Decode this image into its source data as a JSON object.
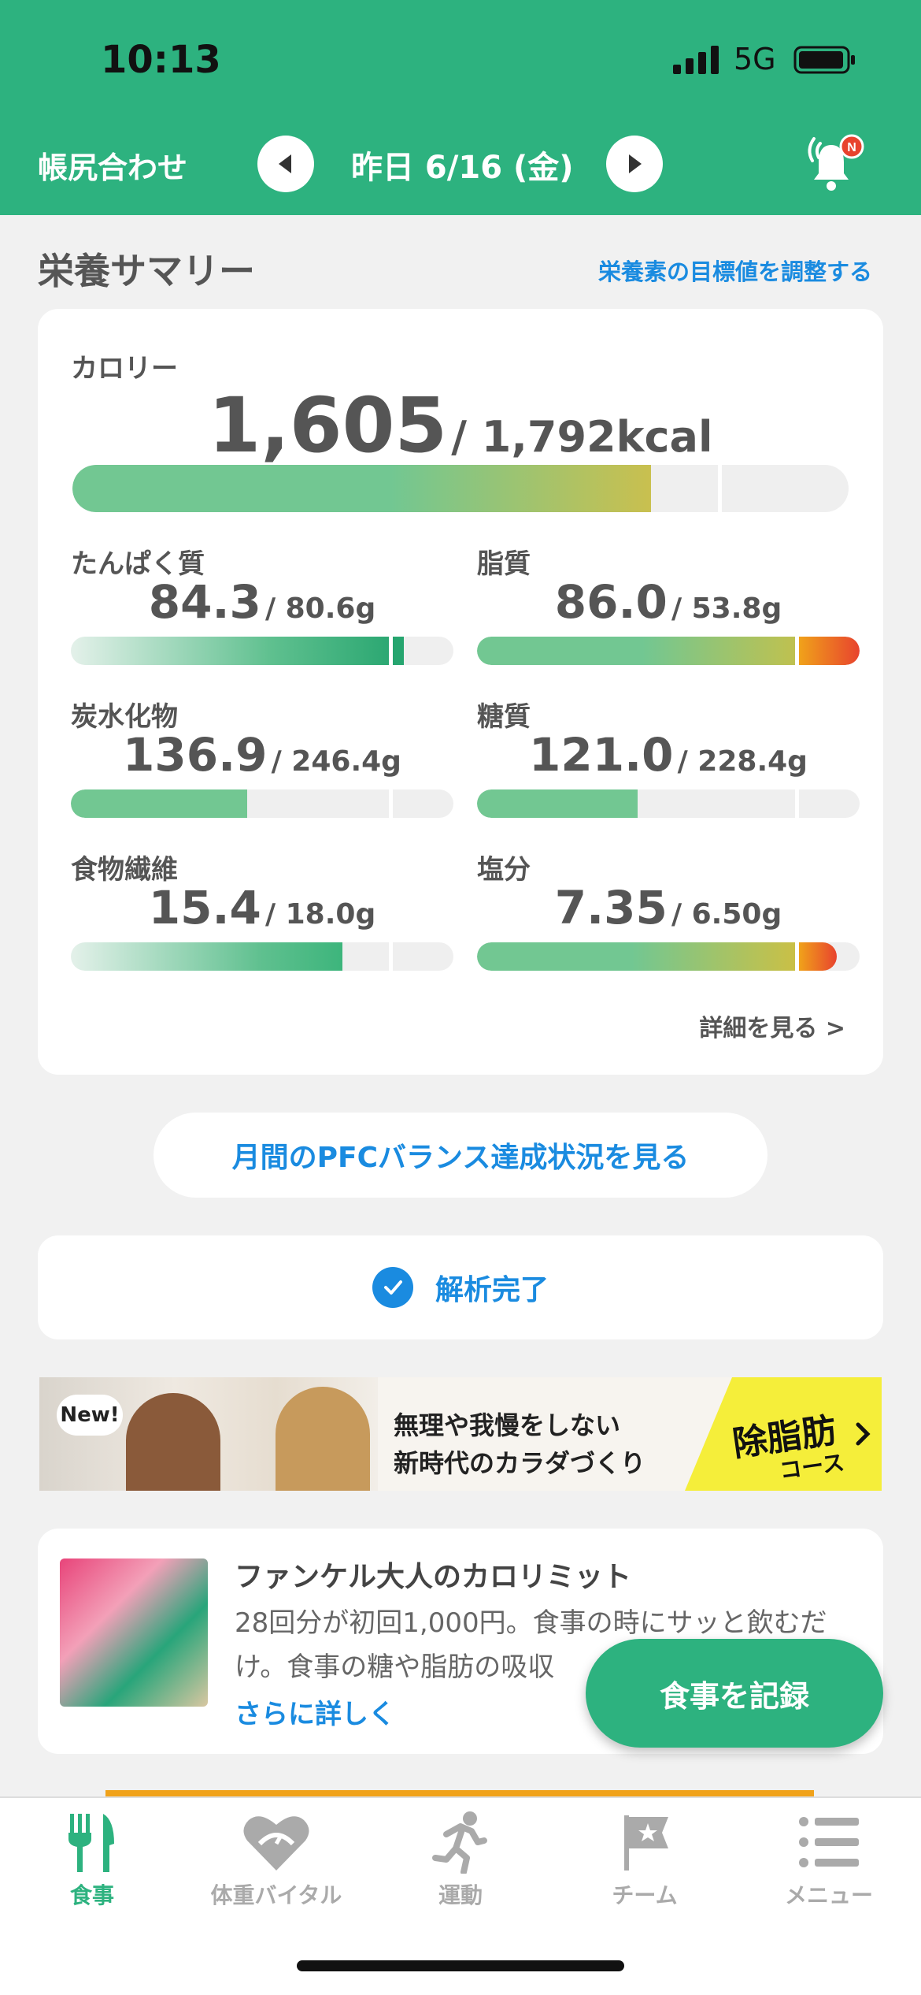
{
  "status_bar": {
    "time": "10:13",
    "network": "5G"
  },
  "header": {
    "left_label": "帳尻合わせ",
    "date": "昨日 6/16 (金)",
    "notification_badge": "N",
    "accent_color": "#2db27f"
  },
  "summary": {
    "title": "栄養サマリー",
    "adjust_link": "栄養素の目標値を調整する",
    "calorie": {
      "label": "カロリー",
      "value": "1,605",
      "target": "/ 1,792kcal",
      "progress": 0.745
    },
    "nutrients": [
      {
        "label": "たんぱく質",
        "value": "84.3",
        "target": "/ 80.6g",
        "progress": 0.87,
        "status": "over"
      },
      {
        "label": "脂質",
        "value": "86.0",
        "target": "/ 53.8g",
        "progress": 0.96,
        "status": "over"
      },
      {
        "label": "炭水化物",
        "value": "136.9",
        "target": "/ 246.4g",
        "progress": 0.46,
        "status": "under"
      },
      {
        "label": "糖質",
        "value": "121.0",
        "target": "/ 228.4g",
        "progress": 0.42,
        "status": "under"
      },
      {
        "label": "食物繊維",
        "value": "15.4",
        "target": "/ 18.0g",
        "progress": 0.71,
        "status": "under"
      },
      {
        "label": "塩分",
        "value": "7.35",
        "target": "/ 6.50g",
        "progress": 0.9,
        "status": "over"
      }
    ],
    "detail_link": "詳細を見る >"
  },
  "pfc_button": "月間のPFCバランス達成状況を見る",
  "analysis": {
    "label": "解析完了"
  },
  "banner": {
    "badge": "New!",
    "line1": "無理や我慢をしない",
    "line2": "新時代のカラダづくり",
    "course_main": "除脂肪",
    "course_sub": "コース"
  },
  "ad": {
    "title": "ファンケル大人のカロリミット",
    "body": "28回分が初回1,000円。食事の時にサッと飲むだけ。食事の糖や脂肪の吸収",
    "more": "さらに詳しく"
  },
  "record_button": "食事を記録",
  "tabs": [
    {
      "label": "食事",
      "icon": "fork-knife-icon",
      "active": true
    },
    {
      "label": "体重バイタル",
      "icon": "heart-scale-icon",
      "active": false
    },
    {
      "label": "運動",
      "icon": "running-icon",
      "active": false
    },
    {
      "label": "チーム",
      "icon": "flag-icon",
      "active": false
    },
    {
      "label": "メニュー",
      "icon": "menu-list-icon",
      "active": false
    }
  ]
}
